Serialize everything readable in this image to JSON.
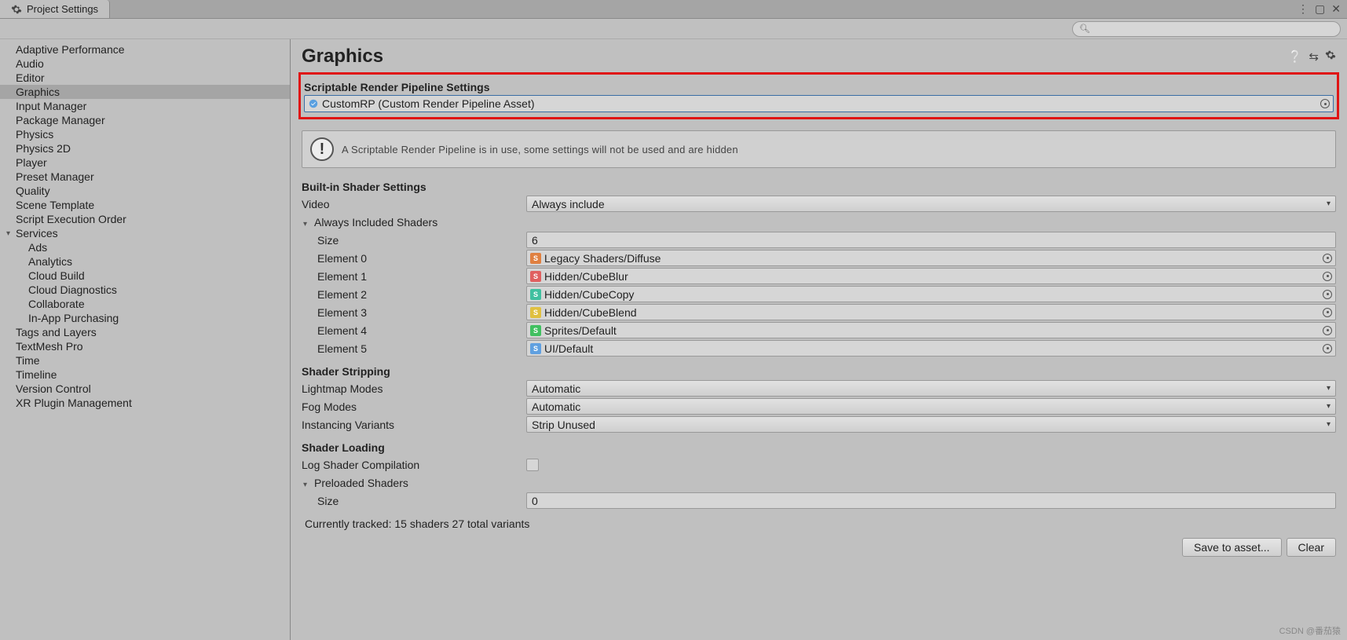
{
  "tab_title": "Project Settings",
  "search_placeholder": "",
  "sidebar": {
    "items": [
      {
        "label": "Adaptive Performance"
      },
      {
        "label": "Audio"
      },
      {
        "label": "Editor"
      },
      {
        "label": "Graphics",
        "selected": true
      },
      {
        "label": "Input Manager"
      },
      {
        "label": "Package Manager"
      },
      {
        "label": "Physics"
      },
      {
        "label": "Physics 2D"
      },
      {
        "label": "Player"
      },
      {
        "label": "Preset Manager"
      },
      {
        "label": "Quality"
      },
      {
        "label": "Scene Template"
      },
      {
        "label": "Script Execution Order"
      },
      {
        "label": "Services",
        "expandable": true
      },
      {
        "label": "Ads",
        "child": true
      },
      {
        "label": "Analytics",
        "child": true
      },
      {
        "label": "Cloud Build",
        "child": true
      },
      {
        "label": "Cloud Diagnostics",
        "child": true
      },
      {
        "label": "Collaborate",
        "child": true
      },
      {
        "label": "In-App Purchasing",
        "child": true
      },
      {
        "label": "Tags and Layers"
      },
      {
        "label": "TextMesh Pro"
      },
      {
        "label": "Time"
      },
      {
        "label": "Timeline"
      },
      {
        "label": "Version Control"
      },
      {
        "label": "XR Plugin Management"
      }
    ]
  },
  "main": {
    "title": "Graphics",
    "srp": {
      "section_title": "Scriptable Render Pipeline Settings",
      "asset": "CustomRP (Custom Render Pipeline Asset)"
    },
    "info_message": "A Scriptable Render Pipeline is in use, some settings will not be used and are hidden",
    "builtin": {
      "section_title": "Built-in Shader Settings",
      "video_label": "Video",
      "video_value": "Always include",
      "always_included_label": "Always Included Shaders",
      "size_label": "Size",
      "size_value": "6",
      "elements": [
        {
          "label": "Element 0",
          "value": "Legacy Shaders/Diffuse",
          "color": "#e08040"
        },
        {
          "label": "Element 1",
          "value": "Hidden/CubeBlur",
          "color": "#e06060"
        },
        {
          "label": "Element 2",
          "value": "Hidden/CubeCopy",
          "color": "#40c0a0"
        },
        {
          "label": "Element 3",
          "value": "Hidden/CubeBlend",
          "color": "#e0c040"
        },
        {
          "label": "Element 4",
          "value": "Sprites/Default",
          "color": "#40c060"
        },
        {
          "label": "Element 5",
          "value": "UI/Default",
          "color": "#60a0e0"
        }
      ]
    },
    "stripping": {
      "section_title": "Shader Stripping",
      "lightmap_label": "Lightmap Modes",
      "lightmap_value": "Automatic",
      "fog_label": "Fog Modes",
      "fog_value": "Automatic",
      "inst_label": "Instancing Variants",
      "inst_value": "Strip Unused"
    },
    "loading": {
      "section_title": "Shader Loading",
      "log_label": "Log Shader Compilation",
      "preloaded_label": "Preloaded Shaders",
      "size_label": "Size",
      "size_value": "0"
    },
    "tracked_text": "Currently tracked: 15 shaders 27 total variants",
    "save_btn": "Save to asset...",
    "clear_btn": "Clear"
  },
  "watermark": "CSDN @番茄猿"
}
